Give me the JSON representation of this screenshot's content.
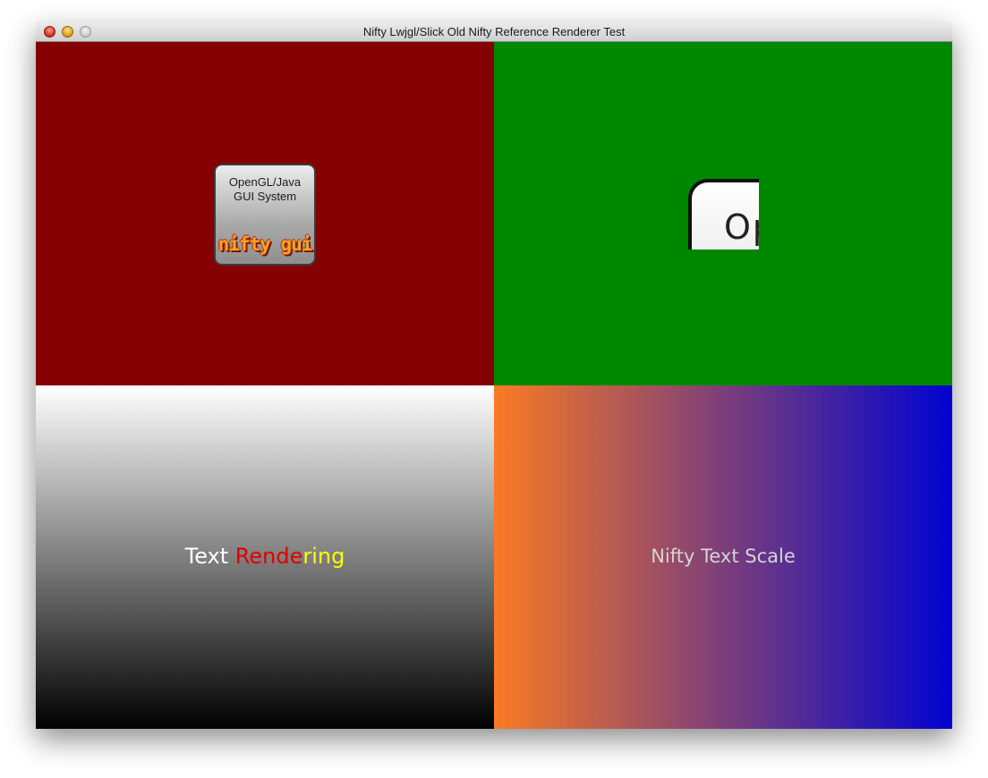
{
  "window": {
    "title": "Nifty Lwjgl/Slick Old Nifty Reference Renderer Test",
    "controls": [
      "close-icon",
      "minimize-icon",
      "zoom-icon"
    ]
  },
  "quadrants": {
    "top_left": {
      "background": "#850000",
      "logo": {
        "line1": "OpenGL/Java",
        "line2": "GUI System",
        "brand": "nifty gui"
      }
    },
    "top_right": {
      "background": "#008700",
      "zoomed_logo_text": "Op"
    },
    "bottom_left": {
      "gradient_top": "#ffffff",
      "gradient_bottom": "#000000",
      "text_parts": {
        "part1": "Text ",
        "part2": "Rende",
        "part3": "ring"
      }
    },
    "bottom_right": {
      "gradient_left": "#f97a24",
      "gradient_right": "#0003cf",
      "text": "Nifty Text Scale"
    }
  }
}
